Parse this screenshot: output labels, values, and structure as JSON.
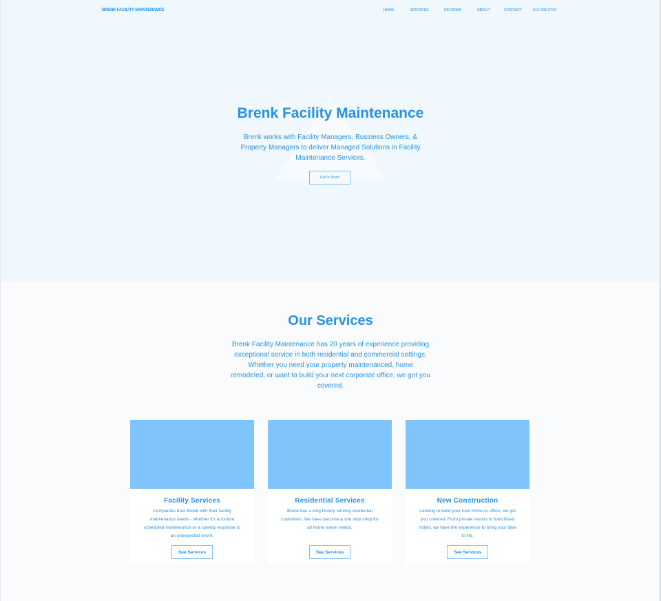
{
  "brand": "BRENK FACILITY MAINTENANCE",
  "nav": {
    "items": [
      {
        "label": "HOME"
      },
      {
        "label": "SERVICES"
      },
      {
        "label": "REVIEWS"
      },
      {
        "label": "ABOUT"
      },
      {
        "label": "CONTACT"
      },
      {
        "label": "512 309-2719"
      }
    ]
  },
  "hero": {
    "title": "Brenk Facility Maintenance",
    "subtitle": "Brenk works with Facility Managers, Business Owners, & Property Managers to deliver Managed Solutions in Facility Maintenance Services.",
    "button": "Get In Touch"
  },
  "services": {
    "title": "Our Services",
    "description": "Brenk Facility Maintenance has 20 years of experience providing exceptional service in both residential and commercial settings. Whether you need your property maintenanced, home remodeled, or want to build your next corporate office, we got you covered.",
    "cards": [
      {
        "title": "Facility Services",
        "text": "Companies trust Brenk with their facility maintenance needs - whether it's a routine scheduled maintenance or a speedy response to an unexpected event.",
        "button": "See Services"
      },
      {
        "title": "Residential Services",
        "text": "Brenk has a long history serving residential customers. We have become a one stop shop for all home owner needs.",
        "button": "See Services"
      },
      {
        "title": "New Construction",
        "text": "Looking to build your next home or office, we got you covered. From private resorts to franchised hotels, we have the experience to bring your idea to life.",
        "button": "See Services"
      }
    ]
  },
  "colors": {
    "accent": "#1e90e6",
    "hero_bg": "#f0f7fd",
    "card_image": "#80c4fc"
  }
}
